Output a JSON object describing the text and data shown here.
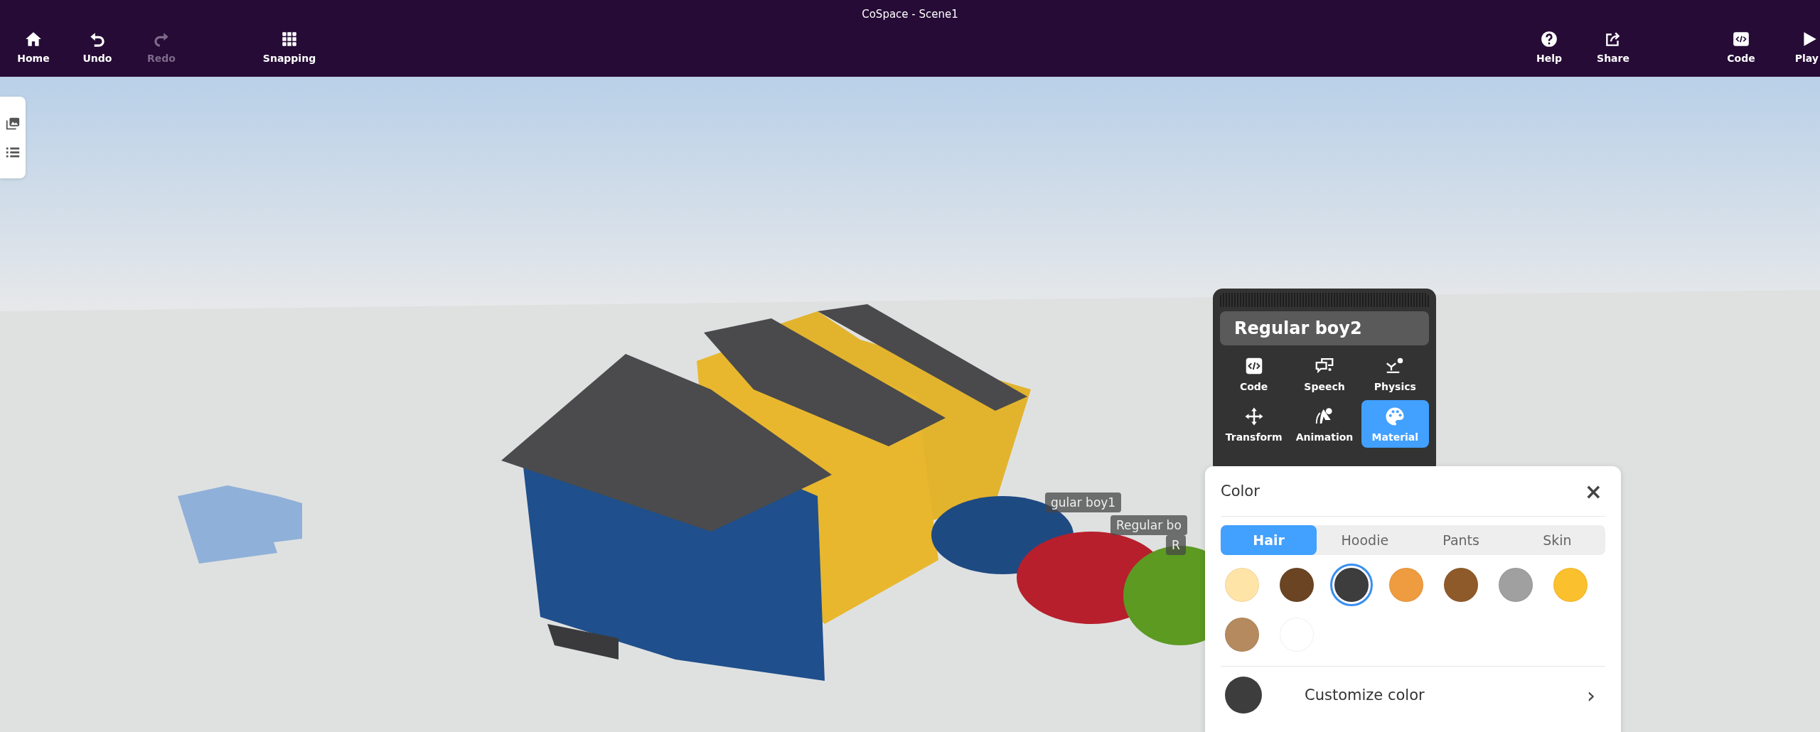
{
  "window": {
    "title": "CoSpace - Scene1"
  },
  "toolbar_left": [
    {
      "label": "Home",
      "disabled": false
    },
    {
      "label": "Undo",
      "disabled": false
    },
    {
      "label": "Redo",
      "disabled": true
    },
    {
      "label": "Snapping",
      "disabled": false
    }
  ],
  "toolbar_right": [
    {
      "label": "Help",
      "disabled": false
    },
    {
      "label": "Share",
      "disabled": false
    },
    {
      "label": "Code",
      "disabled": false
    },
    {
      "label": "Play",
      "disabled": false
    }
  ],
  "scene_labels": [
    "gular boy1",
    "Regular bo",
    "R"
  ],
  "object_menu": {
    "name": "Regular boy2",
    "actions": [
      {
        "label": "Code",
        "selected": false
      },
      {
        "label": "Speech",
        "selected": false
      },
      {
        "label": "Physics",
        "selected": false
      },
      {
        "label": "Transform",
        "selected": false
      },
      {
        "label": "Animation",
        "selected": false
      },
      {
        "label": "Material",
        "selected": true
      }
    ]
  },
  "color_panel": {
    "title": "Color",
    "close": "×",
    "tabs": [
      {
        "label": "Hair",
        "selected": true
      },
      {
        "label": "Hoodie",
        "selected": false
      },
      {
        "label": "Pants",
        "selected": false
      },
      {
        "label": "Skin",
        "selected": false
      }
    ],
    "swatches": [
      {
        "color": "#ffe4a8",
        "selected": false
      },
      {
        "color": "#6b4423",
        "selected": false
      },
      {
        "color": "#3d3d3d",
        "selected": true
      },
      {
        "color": "#ef9b3f",
        "selected": false
      },
      {
        "color": "#8f5a2a",
        "selected": false
      },
      {
        "color": "#a0a0a0",
        "selected": false
      },
      {
        "color": "#fbc02d",
        "selected": false
      },
      {
        "color": "#b58a5e",
        "selected": false
      },
      {
        "color": "#ffffff",
        "selected": false
      }
    ],
    "customize": {
      "label": "Customize color",
      "color": "#3d3d3d",
      "chevron": "›"
    }
  }
}
